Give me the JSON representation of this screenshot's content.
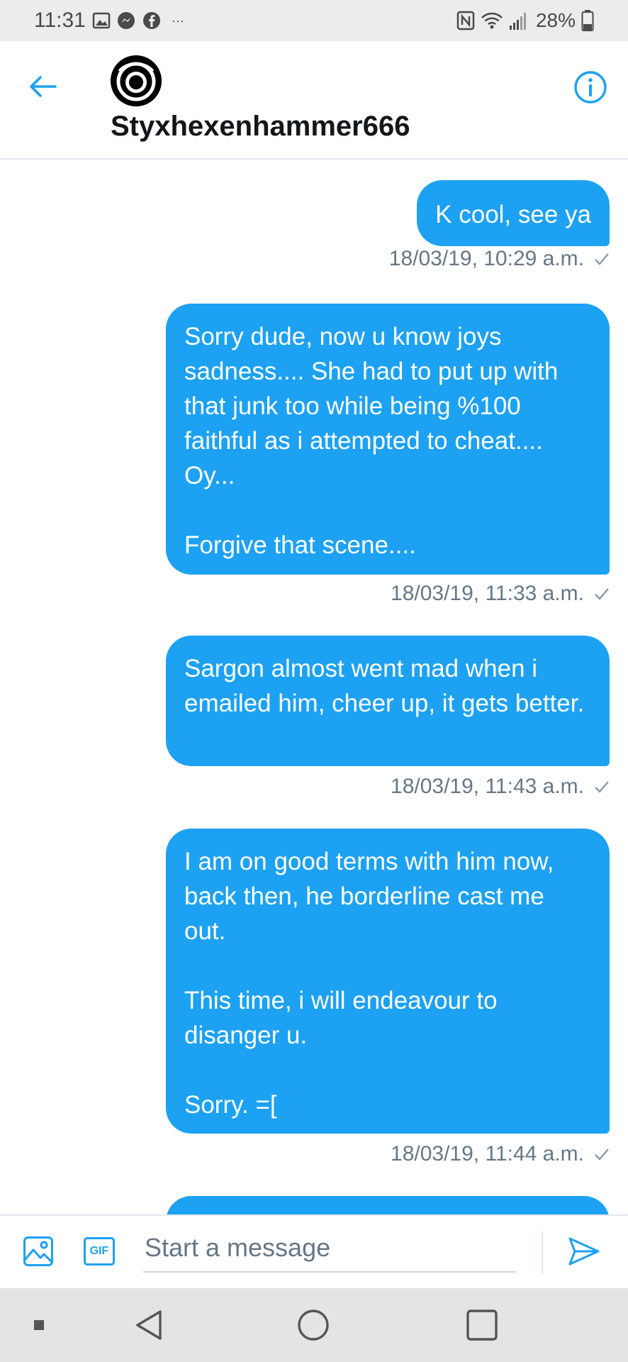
{
  "status_bar": {
    "time": "11:31",
    "left_icons": [
      "gallery-icon",
      "messenger-icon",
      "facebook-icon",
      "more-notifications-icon"
    ],
    "right_icons": [
      "nfc-icon",
      "wifi-icon",
      "signal-icon"
    ],
    "battery_percent": "28%"
  },
  "header": {
    "username": "Styxhexenhammer666",
    "back_icon": "back-arrow-icon",
    "info_icon": "info-icon"
  },
  "messages": [
    {
      "text": "K cool, see ya",
      "timestamp": "18/03/19, 10:29 a.m."
    },
    {
      "text": "Sorry dude, now u know joys sadness.... She had to put up with that junk too while being %100 faithful as i attempted to cheat.... Oy...\n\nForgive that scene....",
      "timestamp": "18/03/19, 11:33 a.m."
    },
    {
      "text": "Sargon almost went mad when i emailed him, cheer up, it gets better.",
      "timestamp": "18/03/19, 11:43 a.m."
    },
    {
      "text": "I am on good terms with him now, back then, he borderline cast me out.\n\nThis time, i will endeavour to disanger u.\n\nSorry. =[",
      "timestamp": "18/03/19, 11:44 a.m."
    },
    {
      "text": "",
      "timestamp": ""
    }
  ],
  "composer": {
    "placeholder": "Start a message",
    "gif_label": "GIF"
  },
  "colors": {
    "accent": "#1da1f2",
    "bubble_text": "#ffffff",
    "timestamp": "#657786"
  }
}
